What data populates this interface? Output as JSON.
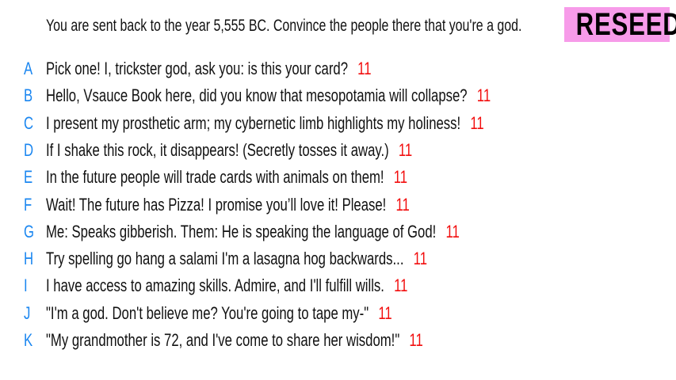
{
  "prompt": "You are sent back to the year 5,555 BC. Convince the people there that you're a god.",
  "reseed_label": "RESEED",
  "colors": {
    "letter": "#1a86f0",
    "score": "#f20d0d",
    "reseed_bg": "#f79be9"
  },
  "options": [
    {
      "letter": "A",
      "text": "Pick one! I, trickster god, ask you: is this your card?",
      "score": "11"
    },
    {
      "letter": "B",
      "text": "Hello, Vsauce Book here, did you know that mesopotamia will collapse?",
      "score": "11"
    },
    {
      "letter": "C",
      "text": "I present my prosthetic arm; my cybernetic limb highlights my holiness!",
      "score": "11"
    },
    {
      "letter": "D",
      "text": "If I shake this rock, it disappears! (Secretly tosses it away.)",
      "score": "11"
    },
    {
      "letter": "E",
      "text": "In the future people will trade cards with animals on them!",
      "score": "11"
    },
    {
      "letter": "F",
      "text": "Wait! The future has Pizza! I promise you’ll love it! Please!",
      "score": "11"
    },
    {
      "letter": "G",
      "text": "Me: Speaks gibberish. Them: He is speaking the language of God!",
      "score": "11"
    },
    {
      "letter": "H",
      "text": "Try spelling go hang a salami I'm a lasagna hog backwards...",
      "score": "11"
    },
    {
      "letter": "I",
      "text": "I have access to amazing skills. Admire, and I'll fulfill wills.",
      "score": "11"
    },
    {
      "letter": "J",
      "text": "\"I'm a god. Don't believe me? You're going to tape my-\"",
      "score": "11"
    },
    {
      "letter": "K",
      "text": "\"My grandmother is 72, and I've come to share her wisdom!\"",
      "score": "11"
    }
  ]
}
